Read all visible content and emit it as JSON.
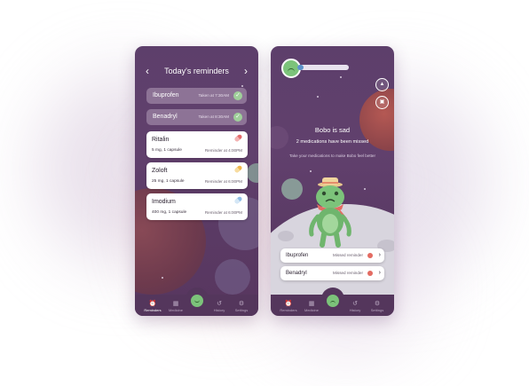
{
  "colors": {
    "sky": "#5d3f6b",
    "taken_pill": "#8d7396",
    "accent_green": "#7cc37a",
    "check_green": "#9fcf9a",
    "missed_red": "#e36b62",
    "progress_blue": "#5c92c9"
  },
  "reminders_screen": {
    "title": "Today's reminders",
    "prev_icon": "chevron-left-icon",
    "next_icon": "chevron-right-icon",
    "taken": [
      {
        "name": "Ibuprofen",
        "status": "Taken at 7:30AM"
      },
      {
        "name": "Benadryl",
        "status": "Taken at 8:30AM"
      }
    ],
    "upcoming": [
      {
        "name": "Ritalin",
        "dose": "5 mg, 1 capsule",
        "reminder": "Reminder at 4:00PM",
        "pill_color": "#e46a6a"
      },
      {
        "name": "Zoloft",
        "dose": "25 mg, 1 capsule",
        "reminder": "Reminder at 6:00PM",
        "pill_color": "#f0b64a"
      },
      {
        "name": "Imodium",
        "dose": "400 mg, 1 capsule",
        "reminder": "Reminder at 6:00PM",
        "pill_color": "#8fbde6"
      }
    ]
  },
  "pet_screen": {
    "mood_progress": 0.12,
    "title": "Bobo is sad",
    "subtitle": "2 medications have been missed",
    "tip": "Take your medications to make Bobo feel better",
    "side_icons": [
      "hanger-icon",
      "camera-icon"
    ],
    "missed": [
      {
        "name": "Ibuprofen",
        "status": "Missed reminder"
      },
      {
        "name": "Benadryl",
        "status": "Missed reminder"
      }
    ]
  },
  "tabbar": {
    "reminders": "Reminders",
    "medicine": "Medicine",
    "history": "History",
    "settings": "Settings"
  }
}
